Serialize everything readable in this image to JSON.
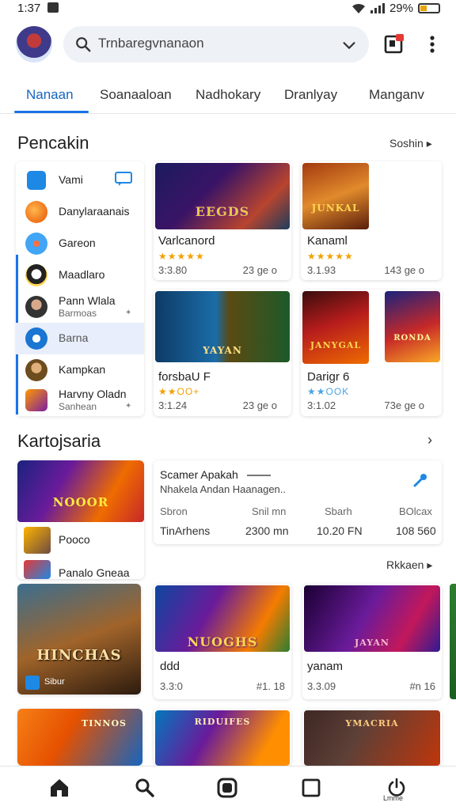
{
  "status_bar": {
    "time": "1:37",
    "battery": "29%"
  },
  "search": {
    "value": "Trnbaregvnanaon"
  },
  "tabs": [
    "Nanaan",
    "Soanaaloan",
    "Nadhokary",
    "Dranlyay",
    "Manganv"
  ],
  "section1": {
    "title": "Pencakin",
    "link": "Soshin ▸"
  },
  "categories": [
    {
      "label": "Vami"
    },
    {
      "label": "Danylaraanais"
    },
    {
      "label": "Gareon"
    },
    {
      "label": "Maadlaro"
    },
    {
      "label": "Pann Wlala",
      "sub": "Barmoas"
    },
    {
      "label": "Barna"
    },
    {
      "label": "Kampkan"
    },
    {
      "label": "Harvny Oladn",
      "sub": "Sanhean"
    }
  ],
  "games_top": [
    {
      "title": "Varlcanord",
      "art": "EEGDS",
      "rating": "★★★★★",
      "meta1": "3:3.80",
      "meta2": "23 ge o"
    },
    {
      "title": "Kanaml",
      "art": "JUNKAL",
      "rating": "★★★★★",
      "meta1": "3.1.93",
      "meta2": "143 ge o"
    },
    {
      "title": "forsbaU F",
      "art": "YAYAN",
      "rating": "★★OO+",
      "meta1": "3:1.24",
      "meta2": "23 ge o"
    },
    {
      "title": "Darigr 6",
      "art": "JANYGAL",
      "rating": "★★OOK",
      "meta1": "3:1.02",
      "meta2": "73e ge o"
    },
    {
      "title": "",
      "art": "RONDA",
      "rating": "",
      "meta1": "",
      "meta2": ""
    }
  ],
  "section2": {
    "title": "Kartojsaria",
    "link": "›",
    "link2": "Rkkaen ▸"
  },
  "featured": {
    "art": "NOOOR",
    "item1": "Pooco",
    "item2": "Panalo Gneaa"
  },
  "info_card": {
    "title": "Scamer Apakah",
    "subtitle": "Nhakela Andan Haanagen..",
    "headers": [
      "Sbron",
      "Snil mn",
      "Sbarh",
      "BOlcax"
    ],
    "values": [
      "TinArhens",
      "2300 mn",
      "10.20 FN",
      "108 560"
    ]
  },
  "games_bottom": [
    {
      "title": "",
      "art": "HINCHAS",
      "rating": "",
      "meta1": "",
      "meta2": "",
      "badge": "Sibur"
    },
    {
      "title": "ddd",
      "art": "NUOGHS",
      "rating": "",
      "meta1": "3.3:0",
      "meta2": "#1. 18"
    },
    {
      "title": "yanam",
      "art": "JAYAN",
      "rating": "",
      "meta1": "3.3.09",
      "meta2": "#n 16"
    }
  ],
  "games_row3": [
    {
      "art": "TINNOS"
    },
    {
      "art": "RIDUIFES"
    },
    {
      "art": "YMACRIA"
    }
  ],
  "bottom_nav": {
    "label": "Lmme"
  },
  "colors": {
    "accent": "#1a73e8",
    "star": "#f2a100"
  }
}
